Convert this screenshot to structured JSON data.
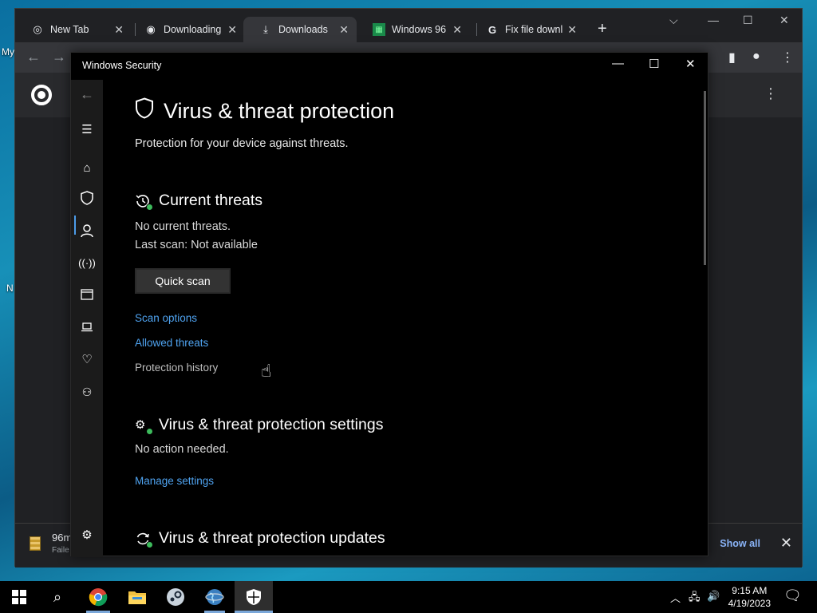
{
  "desktop": {
    "label_top": "My",
    "label_bottom": "N"
  },
  "browser": {
    "tabs": [
      {
        "label": "New Tab",
        "icon": "chrome-icon"
      },
      {
        "label": "Downloading f",
        "icon": "steam-icon"
      },
      {
        "label": "Downloads",
        "icon": "download-icon"
      },
      {
        "label": "Windows 96",
        "icon": "windows96-icon"
      },
      {
        "label": "Fix file downlo",
        "icon": "google-icon"
      }
    ],
    "download": {
      "filename": "96m",
      "status": "Faile",
      "show_all": "Show all"
    }
  },
  "security_window": {
    "title": "Windows Security",
    "page_title": "Virus & threat protection",
    "page_desc": "Protection for your device against threats.",
    "current_threats": {
      "heading": "Current threats",
      "status": "No current threats.",
      "last_scan": "Last scan: Not available",
      "button": "Quick scan",
      "links": [
        "Scan options",
        "Allowed threats",
        "Protection history"
      ]
    },
    "settings": {
      "heading": "Virus & threat protection settings",
      "status": "No action needed.",
      "link": "Manage settings"
    },
    "updates": {
      "heading": "Virus & threat protection updates"
    }
  },
  "taskbar": {
    "time": "9:15 AM",
    "date": "4/19/2023"
  },
  "colors": {
    "link": "#4fa3f0",
    "accent": "#4c9ce8",
    "ok": "#3dbb5c"
  }
}
